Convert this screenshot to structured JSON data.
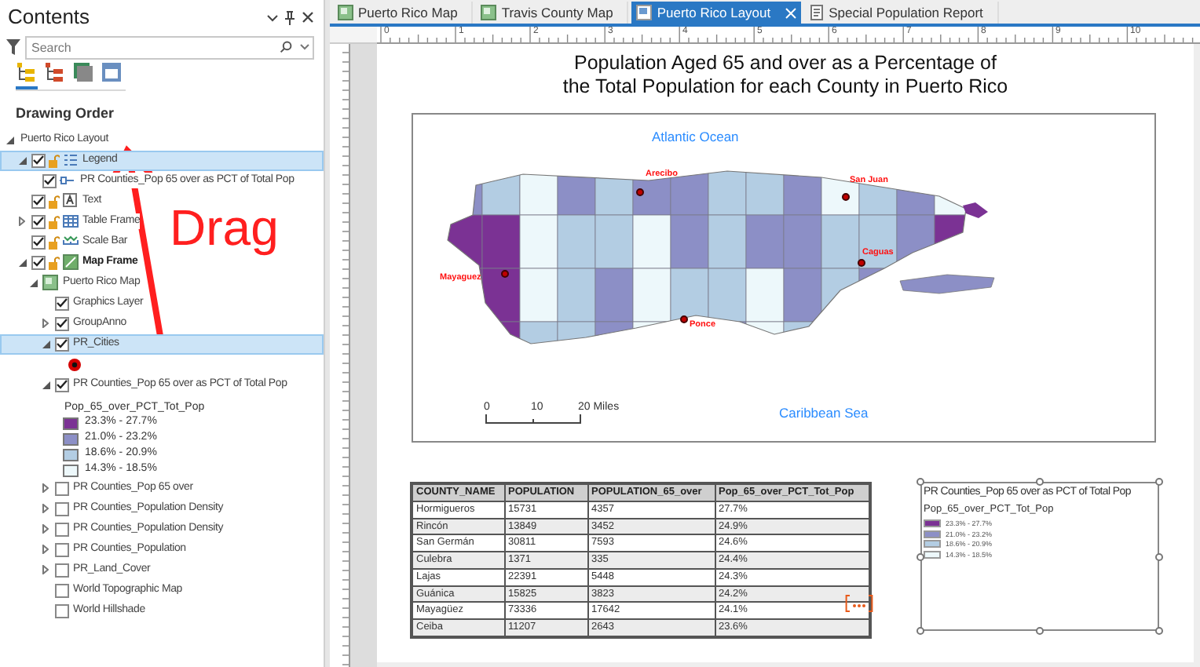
{
  "contents": {
    "title": "Contents",
    "search": {
      "placeholder": "Search"
    },
    "views": [
      {
        "kind": "drawing_order",
        "selected": true
      },
      {
        "kind": "selection",
        "selected": false
      },
      {
        "kind": "snapping",
        "selected": false
      },
      {
        "kind": "labeling",
        "selected": false
      }
    ],
    "heading": "Drawing Order",
    "tree": [
      {
        "label": "Puerto Rico Layout",
        "expanded": true,
        "selected": false,
        "children": [
          {
            "kind": "legend",
            "label": "Legend",
            "checked": true,
            "expanded": true,
            "selected": true,
            "children": [
              {
                "kind": "legend_item",
                "label": "PR Counties_Pop 65 over as PCT of Total Pop",
                "checked": true,
                "selected": false
              }
            ]
          },
          {
            "kind": "text",
            "label": "Text",
            "checked": true,
            "selected": false
          },
          {
            "kind": "table_frame",
            "label": "Table Frame",
            "checked": true,
            "expanded": false,
            "selected": false
          },
          {
            "kind": "scale_bar",
            "label": "Scale Bar",
            "checked": true,
            "selected": false
          },
          {
            "kind": "map_frame",
            "label": "Map Frame",
            "checked": true,
            "expanded": true,
            "selected": false,
            "children": [
              {
                "kind": "map",
                "label": "Puerto Rico Map",
                "expanded": true,
                "selected": false,
                "children": [
                  {
                    "label": "Graphics Layer",
                    "checked": true,
                    "selected": false
                  },
                  {
                    "label": "GroupAnno",
                    "checked": true,
                    "expanded": false,
                    "selected": false
                  },
                  {
                    "label": "PR_Cities",
                    "checked": true,
                    "expanded": true,
                    "selected": true,
                    "children": [
                      {
                        "kind": "point_symbol"
                      }
                    ]
                  },
                  {
                    "label": "PR Counties_Pop 65 over as PCT of Total Pop",
                    "checked": true,
                    "expanded": true,
                    "selected": false,
                    "children": [
                      {
                        "kind": "field",
                        "label": "Pop_65_over_PCT_Tot_Pop"
                      },
                      {
                        "kind": "class",
                        "label": "23.3% - 27.7%",
                        "color": "#7b3294"
                      },
                      {
                        "kind": "class",
                        "label": "21.0% - 23.2%",
                        "color": "#8c8fc6"
                      },
                      {
                        "kind": "class",
                        "label": "18.6% - 20.9%",
                        "color": "#b3cde3"
                      },
                      {
                        "kind": "class",
                        "label": "14.3% - 18.5%",
                        "color": "#edf8fb"
                      }
                    ]
                  },
                  {
                    "label": "PR Counties_Pop 65 over",
                    "checked": false,
                    "expanded": false,
                    "selected": false
                  },
                  {
                    "label": "PR Counties_Population Density",
                    "checked": false,
                    "expanded": false,
                    "selected": false
                  },
                  {
                    "label": "PR Counties_Population Density",
                    "checked": false,
                    "expanded": false,
                    "selected": false
                  },
                  {
                    "label": "PR Counties_Population",
                    "checked": false,
                    "expanded": false,
                    "selected": false
                  },
                  {
                    "label": "PR_Land_Cover",
                    "checked": false,
                    "expanded": false,
                    "selected": false
                  },
                  {
                    "label": "World Topographic Map",
                    "checked": false,
                    "selected": false
                  },
                  {
                    "label": "World Hillshade",
                    "checked": false,
                    "selected": false
                  }
                ]
              }
            ]
          }
        ]
      }
    ]
  },
  "annotation": {
    "text": "Drag"
  },
  "tabs": [
    {
      "kind": "map",
      "label": "Puerto Rico Map",
      "selected": false
    },
    {
      "kind": "map",
      "label": "Travis County Map",
      "selected": false
    },
    {
      "kind": "layout",
      "label": "Puerto Rico Layout",
      "selected": true
    },
    {
      "kind": "report",
      "label": "Special Population Report",
      "selected": false
    }
  ],
  "ruler": {
    "labels": [
      "0",
      "1",
      "2",
      "3",
      "4",
      "5",
      "6",
      "7",
      "8",
      "9",
      "10"
    ]
  },
  "layout": {
    "title_lines": [
      "Population Aged 65 and over as a Percentage of",
      "the Total Population for each County in Puerto Rico"
    ],
    "map": {
      "labels": [
        {
          "kind": "ocean",
          "text": "Atlantic Ocean"
        },
        {
          "kind": "ocean",
          "text": "Caribbean Sea"
        },
        {
          "kind": "city",
          "text": "Arecibo"
        },
        {
          "kind": "city",
          "text": "San Juan"
        },
        {
          "kind": "city",
          "text": "Caguas"
        },
        {
          "kind": "city",
          "text": "Mayaguez"
        },
        {
          "kind": "city",
          "text": "Ponce"
        }
      ],
      "scale_bar": {
        "ticks": [
          "0",
          "10",
          "20 Miles"
        ]
      }
    },
    "table": {
      "columns": [
        "COUNTY_NAME",
        "POPULATION",
        "POPULATION_65_over",
        "Pop_65_over_PCT_Tot_Pop"
      ],
      "rows": [
        [
          "Hormigueros",
          "15731",
          "4357",
          "27.7%"
        ],
        [
          "Rincón",
          "13849",
          "3452",
          "24.9%"
        ],
        [
          "San Germán",
          "30811",
          "7593",
          "24.6%"
        ],
        [
          "Culebra",
          "1371",
          "335",
          "24.4%"
        ],
        [
          "Lajas",
          "22391",
          "5448",
          "24.3%"
        ],
        [
          "Guánica",
          "15825",
          "3823",
          "24.2%"
        ],
        [
          "Mayagüez",
          "73336",
          "17642",
          "24.1%"
        ],
        [
          "Ceiba",
          "11207",
          "2643",
          "23.6%"
        ]
      ]
    },
    "legend": {
      "title": "PR Counties_Pop 65 over as PCT of Total Pop",
      "field": "Pop_65_over_PCT_Tot_Pop",
      "classes": [
        {
          "label": "23.3% - 27.7%",
          "color": "#7b3294"
        },
        {
          "label": "21.0% - 23.2%",
          "color": "#8c8fc6"
        },
        {
          "label": "18.6% - 20.9%",
          "color": "#b3cde3"
        },
        {
          "label": "14.3% - 18.5%",
          "color": "#edf8fb"
        }
      ]
    }
  }
}
